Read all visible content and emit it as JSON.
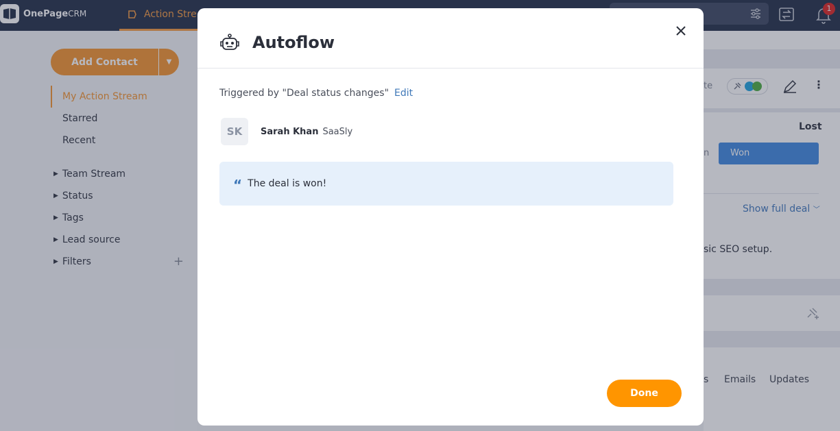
{
  "app": {
    "logo_main": "OnePage",
    "logo_suffix": "CRM"
  },
  "topbar": {
    "tab_label": "Action Stre",
    "notification_count": "1"
  },
  "sidebar": {
    "add_contact_label": "Add Contact",
    "nav_items": [
      "My Action Stream",
      "Starred",
      "Recent"
    ],
    "groups": [
      "Team Stream",
      "Status",
      "Tags",
      "Lead source",
      "Filters"
    ]
  },
  "background": {
    "partial_button": "te",
    "lost_label": "Lost",
    "partial_stage": "n",
    "won_label": "Won",
    "show_full_deal": "Show full deal",
    "description_partial": "sic SEO setup.",
    "tabs_partial": "s",
    "tab_emails": "Emails",
    "tab_updates": "Updates"
  },
  "modal": {
    "title": "Autoflow",
    "trigger_text": "Triggered by \"Deal status changes\"",
    "edit_label": "Edit",
    "contact": {
      "initials": "SK",
      "name": "Sarah Khan",
      "company": "SaaSly"
    },
    "quote": "The deal is won!",
    "done_label": "Done"
  },
  "colors": {
    "accent": "#f59a3a",
    "primary_button": "#ff9500",
    "link": "#3f78b8",
    "quote_bg": "#e6f0fb",
    "won_stage": "#4a90e2"
  }
}
